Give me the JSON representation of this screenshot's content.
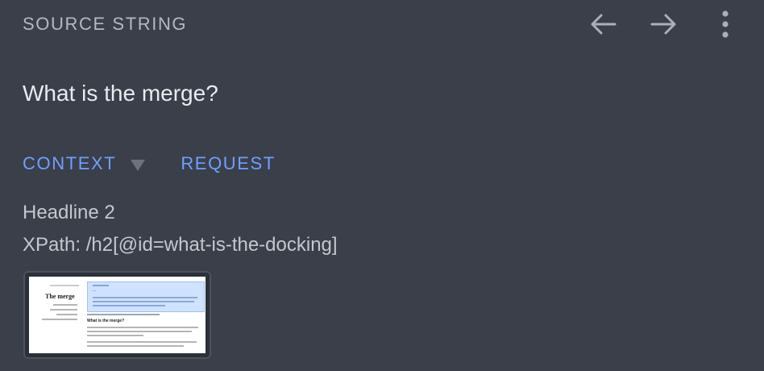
{
  "header": {
    "title": "SOURCE STRING",
    "back_icon": "arrow-left-icon",
    "forward_icon": "arrow-right-icon",
    "more_icon": "more-vertical-icon"
  },
  "source": {
    "text": "What is the merge?"
  },
  "tabs": [
    {
      "label": "CONTEXT"
    },
    {
      "label": "REQUEST"
    }
  ],
  "context": {
    "element_type": "Headline 2",
    "xpath": "XPath: /h2[@id=what-is-the-docking]"
  },
  "thumbnail": {
    "page_title": "The merge",
    "panel_heading": "...",
    "section_heading": "What is the merge?"
  },
  "colors": {
    "background": "#3a3f4a",
    "accent": "#6ea0ff",
    "muted_text": "#b4b9c1"
  }
}
